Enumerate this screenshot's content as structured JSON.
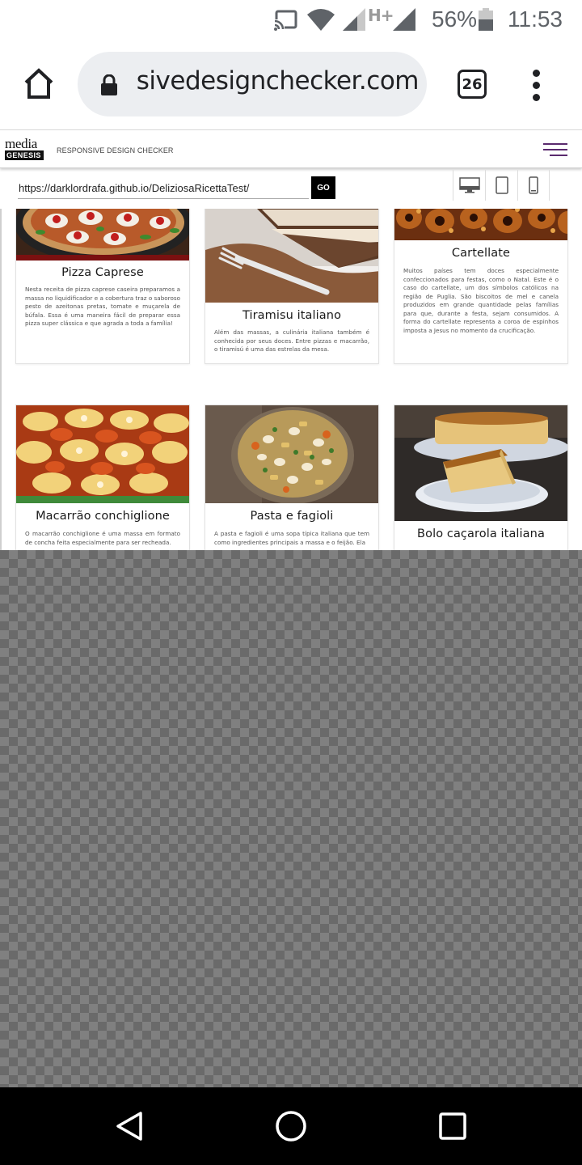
{
  "status_bar": {
    "network_label": "H+",
    "battery_percent": "56%",
    "time": "11:53",
    "icons": [
      "cast-icon",
      "wifi-icon",
      "cell-signal-icon",
      "cell-signal-icon",
      "battery-icon"
    ]
  },
  "browser": {
    "omnibox_url": "responsivedesignchecker.com",
    "tab_count": "26"
  },
  "site": {
    "logo_line1": "media",
    "logo_line2": "GENESIS",
    "tagline": "RESPONSIVE DESIGN CHECKER",
    "url_input_value": "https://darklordrafa.github.io/DeliziosaRicettaTest/",
    "go_label": "GO",
    "device_buttons": [
      "desktop-icon",
      "tablet-icon",
      "phone-icon"
    ],
    "accent_color": "#5a2a6e"
  },
  "cards": [
    {
      "title": "Pizza Caprese",
      "description": "Nesta receita de pizza caprese caseira preparamos a massa no liquidificador e a cobertura traz o saboroso pesto de azeitonas pretas, tomate e muçarela de búfala. Essa é uma maneira fácil de preparar essa pizza super clássica e que agrada a toda a família!"
    },
    {
      "title": "Tiramisu italiano",
      "description": "Além das massas, a culinária italiana também é conhecida por seus doces. Entre pizzas e macarrão, o tiramisú é uma das estrelas da mesa."
    },
    {
      "title": "Cartellate",
      "description": "Muitos países tem doces especialmente confeccionados para festas, como o Natal. Este é o caso do cartellate, um dos símbolos católicos na região de Puglia. São biscoitos de mel e canela produzidos em grande quantidade pelas famílias para que, durante a festa, sejam consumidos. A forma do cartellate representa a coroa de espinhos imposta a Jesus no momento da crucificação."
    },
    {
      "title": "Macarrão conchiglione",
      "description": "O macarrão conchiglione é uma massa em formato de concha feita especialmente para ser recheada."
    },
    {
      "title": "Pasta e fagioli",
      "description": "A pasta e fagioli é uma sopa típica italiana que tem como ingredientes principais a massa e o feijão. Ela"
    },
    {
      "title": "Bolo caçarola italiana",
      "description": ""
    }
  ]
}
